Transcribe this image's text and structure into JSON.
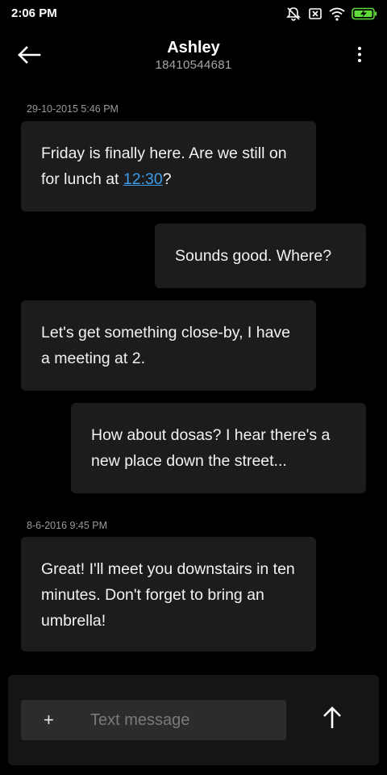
{
  "status_bar": {
    "time": "2:06 PM",
    "icons": [
      "notifications-off-icon",
      "sim-off-icon",
      "wifi-icon",
      "battery-charging-icon"
    ]
  },
  "header": {
    "contact_name": "Ashley",
    "contact_number": "18410544681",
    "back_icon": "arrow-left-icon",
    "menu_icon": "more-vertical-icon"
  },
  "conversation": {
    "timestamp_1": "29-10-2015 5:46 PM",
    "msg_1_text": "Friday is finally here. Are we still on for lunch at ",
    "msg_1_link": "12:30",
    "msg_1_end": "?",
    "msg_2": "Sounds good. Where?",
    "msg_3": "Let's get something close-by, I have a meeting at 2.",
    "msg_4": "How about dosas? I hear there's a new place down the street...",
    "timestamp_2": "8-6-2016 9:45 PM",
    "msg_5": "Great! I'll meet you downstairs in ten minutes. Don't forget to bring an umbrella!"
  },
  "composer": {
    "add_label": "+",
    "placeholder": "Text message",
    "value": "",
    "send_icon": "arrow-up-icon"
  },
  "colors": {
    "background": "#000000",
    "bubble": "#1c1c1c",
    "composer": "#151515",
    "input": "#2c2c2c",
    "link": "#3d9be9",
    "secondary_text": "#9a9a9a"
  }
}
